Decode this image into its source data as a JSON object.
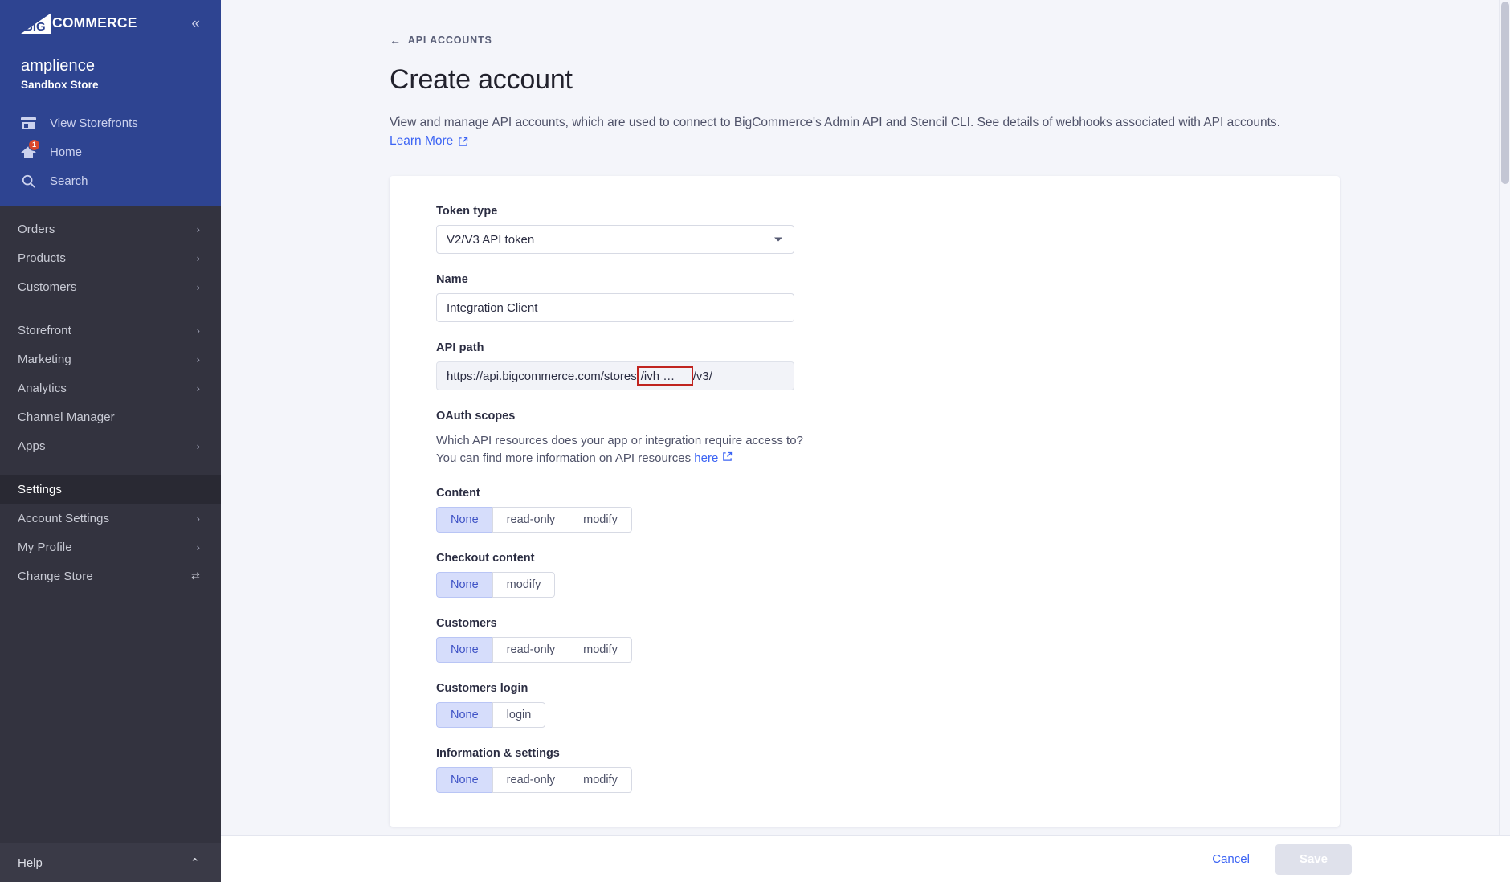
{
  "sidebar": {
    "logo_text": "COMMERCE",
    "logo_mark_name": "bigcommerce-logo",
    "collapse_icon": "«",
    "store_name": "amplience",
    "store_plan": "Sandbox Store",
    "quick_items": [
      {
        "label": "View Storefronts",
        "icon": "storefront-icon",
        "badge": ""
      },
      {
        "label": "Home",
        "icon": "home-icon",
        "badge": "1"
      },
      {
        "label": "Search",
        "icon": "search-icon",
        "badge": ""
      }
    ],
    "nav_group_1": [
      {
        "label": "Orders",
        "chevron": "›"
      },
      {
        "label": "Products",
        "chevron": "›"
      },
      {
        "label": "Customers",
        "chevron": "›"
      }
    ],
    "nav_group_2": [
      {
        "label": "Storefront",
        "chevron": "›"
      },
      {
        "label": "Marketing",
        "chevron": "›"
      },
      {
        "label": "Analytics",
        "chevron": "›"
      },
      {
        "label": "Channel Manager",
        "chevron": ""
      },
      {
        "label": "Apps",
        "chevron": "›"
      }
    ],
    "nav_group_3": [
      {
        "label": "Settings",
        "chevron": "",
        "active": true
      },
      {
        "label": "Account Settings",
        "chevron": "›"
      },
      {
        "label": "My Profile",
        "chevron": "›"
      },
      {
        "label": "Change Store",
        "chevron": "⇄"
      }
    ],
    "help_label": "Help",
    "help_chevron": "⌃"
  },
  "header": {
    "breadcrumb": "API ACCOUNTS",
    "breadcrumb_arrow": "←",
    "title": "Create account",
    "description": "View and manage API accounts, which are used to connect to BigCommerce's Admin API and Stencil CLI. See details of webhooks associated with API accounts.",
    "learn_more": "Learn More"
  },
  "form": {
    "token_type": {
      "label": "Token type",
      "value": "V2/V3 API token",
      "options": [
        "V2/V3 API token"
      ]
    },
    "name": {
      "label": "Name",
      "value": "Integration Client",
      "placeholder": ""
    },
    "api_path": {
      "label": "API path",
      "prefix": "https://api.bigcommerce.com/stores",
      "redacted_value": "/ivh …",
      "suffix": "/v3/"
    },
    "oauth": {
      "heading": "OAuth scopes",
      "line1": "Which API resources does your app or integration require access to?",
      "line2_prefix": "You can find more information on API resources ",
      "line2_link": "here"
    },
    "scopes": [
      {
        "label": "Content",
        "options": [
          "None",
          "read-only",
          "modify"
        ],
        "selected": "None"
      },
      {
        "label": "Checkout content",
        "options": [
          "None",
          "modify"
        ],
        "selected": "None"
      },
      {
        "label": "Customers",
        "options": [
          "None",
          "read-only",
          "modify"
        ],
        "selected": "None"
      },
      {
        "label": "Customers login",
        "options": [
          "None",
          "login"
        ],
        "selected": "None"
      },
      {
        "label": "Information & settings",
        "options": [
          "None",
          "read-only",
          "modify"
        ],
        "selected": "None"
      }
    ]
  },
  "footer": {
    "cancel_label": "Cancel",
    "save_label": "Save",
    "save_disabled": true
  },
  "colors": {
    "sidebar_top": "#2e4491",
    "sidebar_body": "#33333f",
    "accent_link": "#3c64f4",
    "selected_segment_bg": "#d6ddfb",
    "selected_segment_text": "#3f53c6",
    "redaction_border": "#c0241f",
    "badge_bg": "#d9472b",
    "page_bg": "#f4f5fa"
  }
}
